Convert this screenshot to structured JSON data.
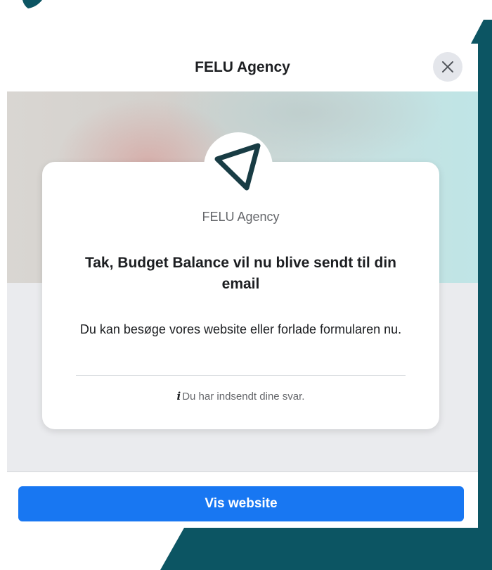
{
  "modal": {
    "title": "FELU Agency",
    "close_icon": "close-icon"
  },
  "card": {
    "logo_icon": "triangle-logo-icon",
    "org_name": "FELU Agency",
    "headline": "Tak, Budget Balance vil nu blive sendt til din email",
    "subtext": "Du kan besøge vores website eller forlade formularen nu.",
    "note_icon": "info-icon",
    "note": "Du har indsendt dine svar."
  },
  "footer": {
    "button_label": "Vis website"
  },
  "colors": {
    "brand_teal": "#0c5563",
    "button_blue": "#1877f2",
    "logo_dark": "#183c44"
  }
}
